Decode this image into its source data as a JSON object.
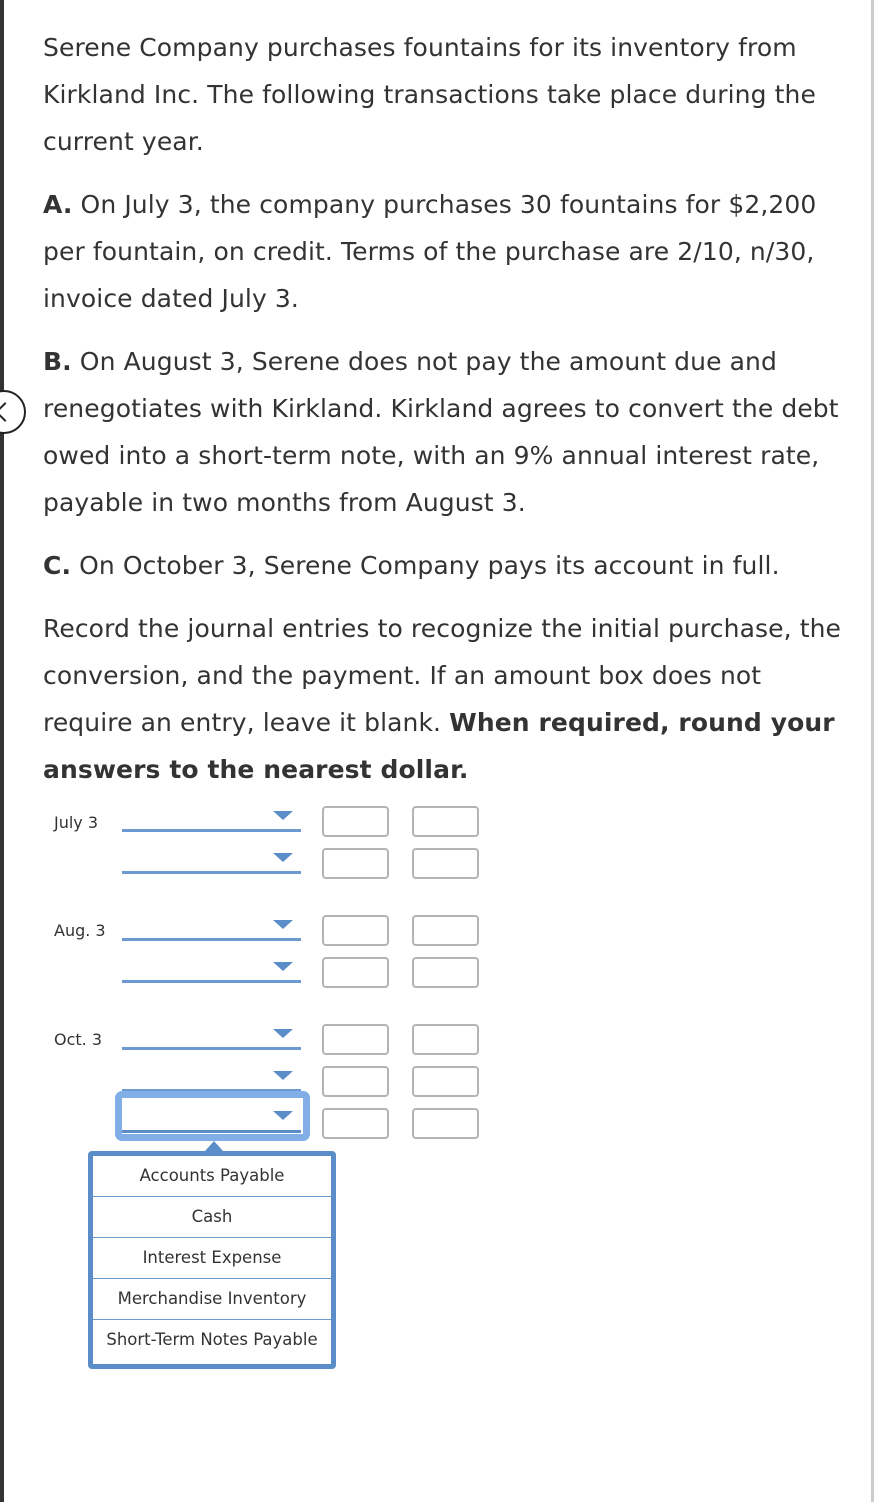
{
  "problem": {
    "intro": "Serene Company purchases fountains for its inventory from Kirkland Inc. The following transactions take place during the current year.",
    "parts": [
      {
        "letter": "A.",
        "text": " On July 3, the company purchases 30 fountains for $2,200 per fountain, on credit. Terms of the purchase are 2/10, n/30, invoice dated July 3."
      },
      {
        "letter": "B.",
        "text": " On August 3, Serene does not pay the amount due and renegotiates with Kirkland. Kirkland agrees to convert the debt owed into a short-term note, with an 9% annual interest rate, payable in two months from August 3."
      },
      {
        "letter": "C.",
        "text": " On October 3, Serene Company pays its account in full."
      }
    ],
    "instructions": "Record the journal entries to recognize the initial purchase, the conversion, and the payment. If an amount box does not require an entry, leave it blank. ",
    "instructions_bold": "When required, round your answers to the nearest dollar."
  },
  "journal": {
    "entries": [
      {
        "date": "July 3",
        "rows": [
          {
            "account": "",
            "debit": "",
            "credit": ""
          },
          {
            "account": "",
            "debit": "",
            "credit": ""
          }
        ]
      },
      {
        "date": "Aug. 3",
        "rows": [
          {
            "account": "",
            "debit": "",
            "credit": ""
          },
          {
            "account": "",
            "debit": "",
            "credit": ""
          }
        ]
      },
      {
        "date": "Oct. 3",
        "rows": [
          {
            "account": "",
            "debit": "",
            "credit": ""
          },
          {
            "account": "",
            "debit": "",
            "credit": ""
          },
          {
            "account": "",
            "debit": "",
            "credit": ""
          }
        ]
      }
    ]
  },
  "dropdown": {
    "open": true,
    "options": [
      "Accounts Payable",
      "Cash",
      "Interest Expense",
      "Merchandise Inventory",
      "Short-Term Notes Payable"
    ]
  },
  "colors": {
    "accent": "#5b8ec9",
    "focus": "#82aee8",
    "text": "#333333",
    "input_border": "#b4b4b4"
  }
}
